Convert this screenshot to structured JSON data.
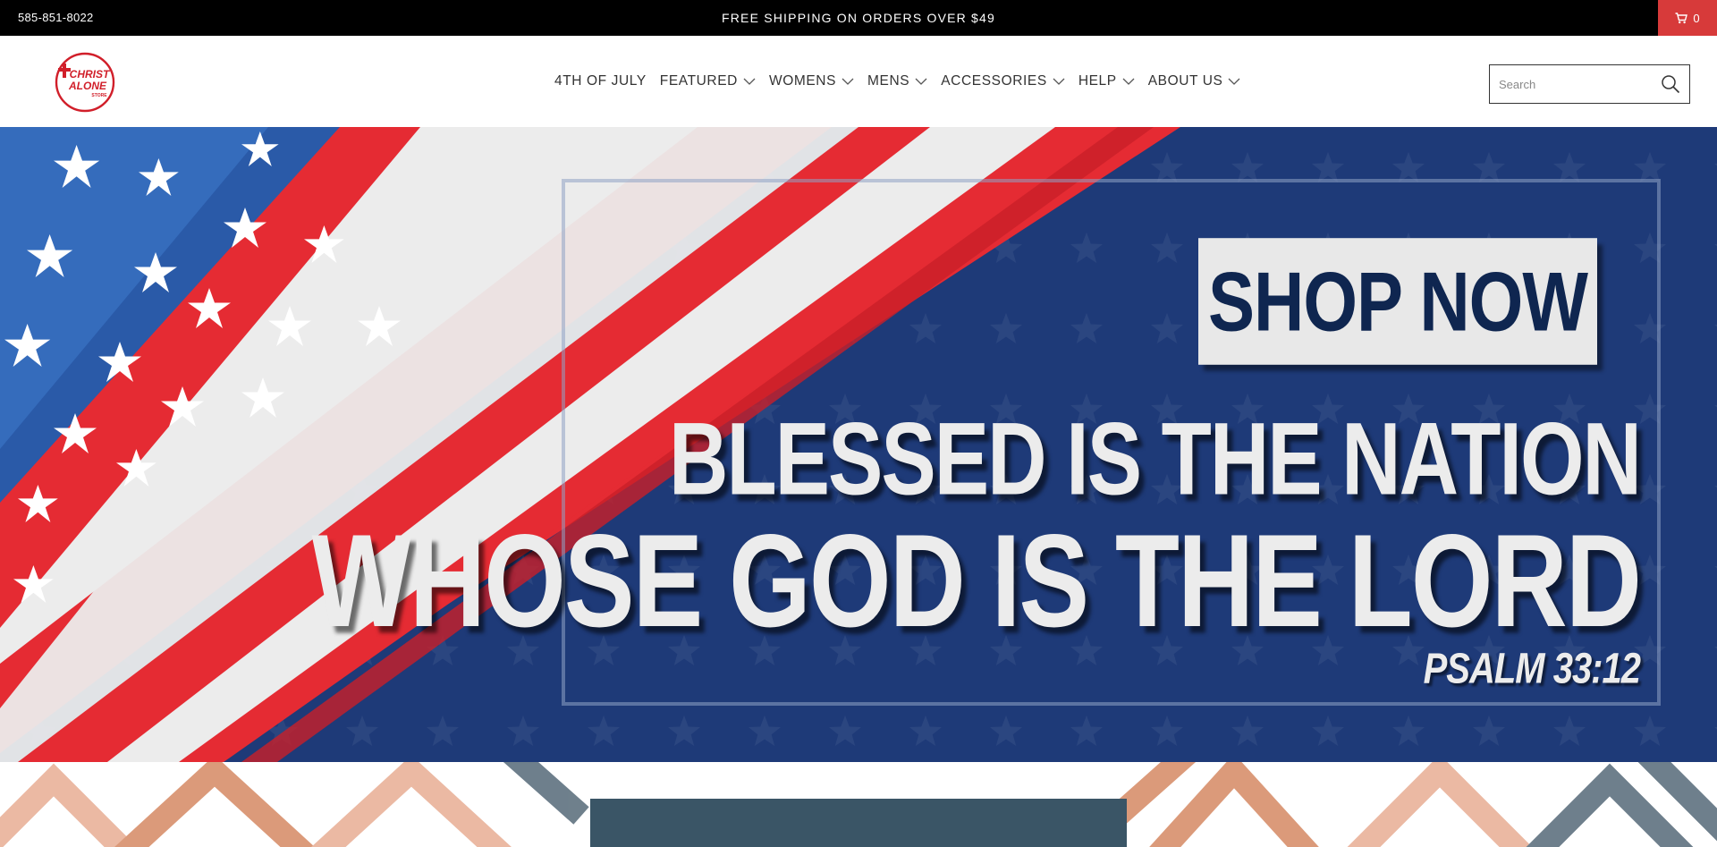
{
  "topbar": {
    "phone": "585-851-8022",
    "announcement": "FREE SHIPPING ON ORDERS OVER $49",
    "cart_count": "0",
    "cart_icon": "cart-icon",
    "cart_color": "#d73a3a"
  },
  "header": {
    "logo_alt": "Christ Alone Store logo",
    "logo_text": {
      "line1": "CHRIST",
      "line2": "ALONE",
      "line3": "STORE"
    },
    "nav": [
      {
        "label": "4TH OF JULY",
        "has_dropdown": false
      },
      {
        "label": "FEATURED",
        "has_dropdown": true
      },
      {
        "label": "WOMENS",
        "has_dropdown": true
      },
      {
        "label": "MENS",
        "has_dropdown": true
      },
      {
        "label": "ACCESSORIES",
        "has_dropdown": true
      },
      {
        "label": "HELP",
        "has_dropdown": true
      },
      {
        "label": "ABOUT US",
        "has_dropdown": true
      }
    ],
    "search": {
      "placeholder": "Search",
      "value": "",
      "icon": "search-icon"
    }
  },
  "hero": {
    "button_label": "SHOP NOW",
    "line1": "BLESSED IS THE NATION",
    "line2": "WHOSE GOD IS THE LORD",
    "verse": "PSALM 33:12",
    "colors": {
      "navy": "#1e3a78",
      "red": "#e52b33",
      "white": "#ececec",
      "button_text": "#0f2650"
    }
  },
  "promo": {
    "box_color": "#3a5566"
  }
}
